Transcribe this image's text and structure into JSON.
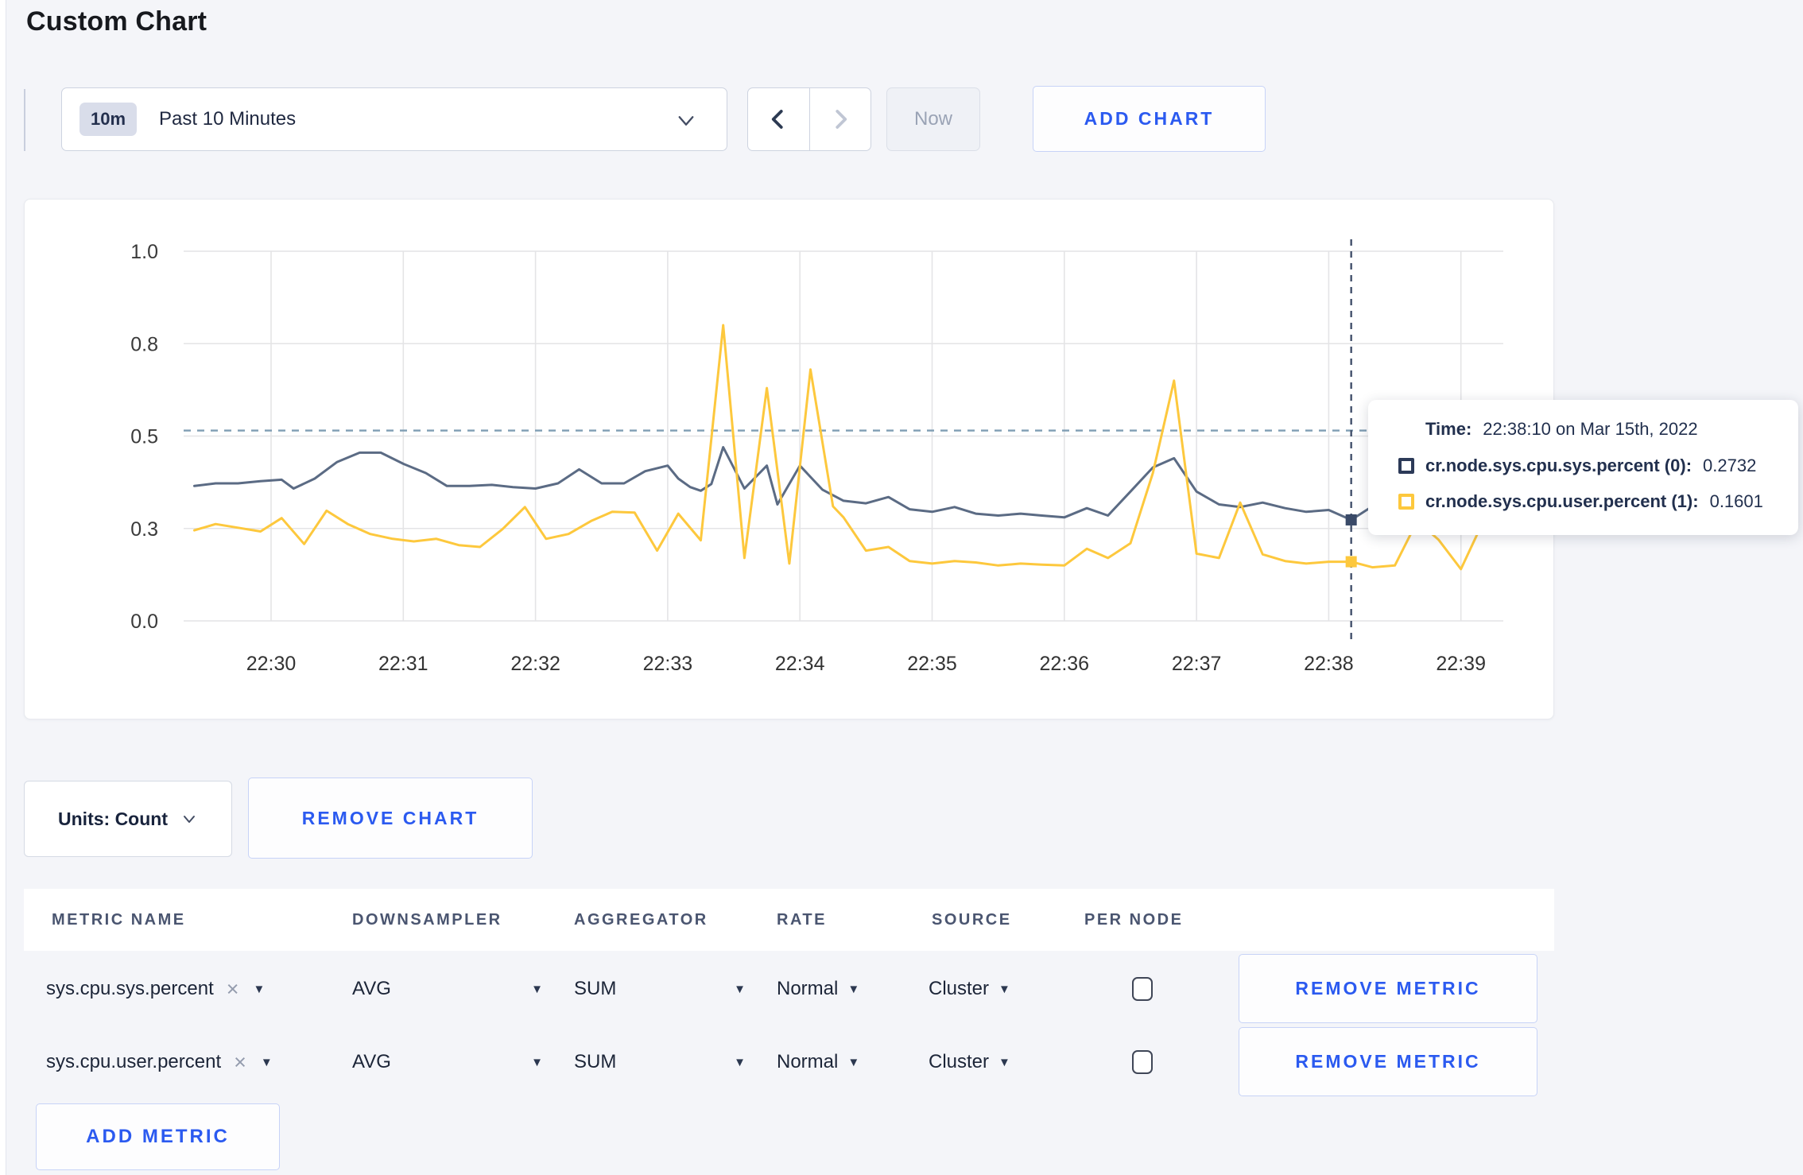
{
  "page": {
    "title": "Custom Chart"
  },
  "toolbar": {
    "timescale_badge": "10m",
    "timescale_label": "Past 10 Minutes",
    "now_label": "Now",
    "add_chart_label": "ADD CHART"
  },
  "chart_controls": {
    "units_label": "Units: Count",
    "remove_chart_label": "REMOVE CHART"
  },
  "tooltip": {
    "time_label": "Time:",
    "time_value": "22:38:10 on Mar 15th, 2022",
    "rows": [
      {
        "name": "cr.node.sys.cpu.sys.percent (0):",
        "value": "0.2732",
        "color": "#2c3a58"
      },
      {
        "name": "cr.node.sys.cpu.user.percent (1):",
        "value": "0.1601",
        "color": "#fdc83d"
      }
    ]
  },
  "chart_data": {
    "type": "line",
    "title": "",
    "xlabel": "",
    "ylabel": "",
    "ylim": [
      0,
      1
    ],
    "grid": true,
    "y_ticks": [
      {
        "value": 0,
        "label": "0.0"
      },
      {
        "value": 0.25,
        "label": "0.3"
      },
      {
        "value": 0.5,
        "label": "0.5"
      },
      {
        "value": 0.75,
        "label": "0.8"
      },
      {
        "value": 1,
        "label": "1.0"
      }
    ],
    "x_ticks": [
      {
        "minute": 30,
        "label": "22:30"
      },
      {
        "minute": 31,
        "label": "22:31"
      },
      {
        "minute": 32,
        "label": "22:32"
      },
      {
        "minute": 33,
        "label": "22:33"
      },
      {
        "minute": 34,
        "label": "22:34"
      },
      {
        "minute": 35,
        "label": "22:35"
      },
      {
        "minute": 36,
        "label": "22:36"
      },
      {
        "minute": 37,
        "label": "22:37"
      },
      {
        "minute": 38,
        "label": "22:38"
      },
      {
        "minute": 39,
        "label": "22:39"
      }
    ],
    "guideline_value": 0.515,
    "crosshair": {
      "minute": 38.17,
      "time": "22:38:10",
      "points": [
        {
          "series": "cr.node.sys.cpu.sys.percent",
          "value": 0.2732,
          "color": "#3a4a68"
        },
        {
          "series": "cr.node.sys.cpu.user.percent",
          "value": 0.1601,
          "color": "#fdc83d"
        }
      ]
    },
    "series": [
      {
        "name": "cr.node.sys.cpu.sys.percent",
        "color": "#5b6b84",
        "points": [
          [
            29.42,
            0.365
          ],
          [
            29.58,
            0.372
          ],
          [
            29.75,
            0.372
          ],
          [
            29.92,
            0.378
          ],
          [
            30.08,
            0.382
          ],
          [
            30.17,
            0.358
          ],
          [
            30.33,
            0.385
          ],
          [
            30.5,
            0.43
          ],
          [
            30.67,
            0.455
          ],
          [
            30.83,
            0.455
          ],
          [
            31.0,
            0.425
          ],
          [
            31.17,
            0.4
          ],
          [
            31.33,
            0.365
          ],
          [
            31.5,
            0.365
          ],
          [
            31.67,
            0.368
          ],
          [
            31.83,
            0.362
          ],
          [
            32.0,
            0.358
          ],
          [
            32.17,
            0.372
          ],
          [
            32.33,
            0.41
          ],
          [
            32.5,
            0.372
          ],
          [
            32.67,
            0.372
          ],
          [
            32.83,
            0.405
          ],
          [
            33.0,
            0.42
          ],
          [
            33.08,
            0.385
          ],
          [
            33.17,
            0.362
          ],
          [
            33.25,
            0.352
          ],
          [
            33.33,
            0.37
          ],
          [
            33.42,
            0.47
          ],
          [
            33.58,
            0.358
          ],
          [
            33.75,
            0.42
          ],
          [
            33.83,
            0.315
          ],
          [
            34.0,
            0.42
          ],
          [
            34.17,
            0.355
          ],
          [
            34.33,
            0.325
          ],
          [
            34.5,
            0.318
          ],
          [
            34.67,
            0.335
          ],
          [
            34.83,
            0.302
          ],
          [
            35.0,
            0.295
          ],
          [
            35.17,
            0.308
          ],
          [
            35.33,
            0.29
          ],
          [
            35.5,
            0.285
          ],
          [
            35.67,
            0.29
          ],
          [
            35.83,
            0.285
          ],
          [
            36.0,
            0.28
          ],
          [
            36.17,
            0.305
          ],
          [
            36.33,
            0.285
          ],
          [
            36.5,
            0.35
          ],
          [
            36.67,
            0.415
          ],
          [
            36.83,
            0.44
          ],
          [
            37.0,
            0.35
          ],
          [
            37.17,
            0.315
          ],
          [
            37.33,
            0.308
          ],
          [
            37.5,
            0.32
          ],
          [
            37.67,
            0.305
          ],
          [
            37.83,
            0.295
          ],
          [
            38.0,
            0.3
          ],
          [
            38.17,
            0.2732
          ],
          [
            38.33,
            0.31
          ],
          [
            38.5,
            0.315
          ],
          [
            38.67,
            0.3
          ],
          [
            38.83,
            0.3
          ],
          [
            39.0,
            0.302
          ],
          [
            39.17,
            0.3
          ],
          [
            39.25,
            0.298
          ]
        ]
      },
      {
        "name": "cr.node.sys.cpu.user.percent",
        "color": "#fdc83d",
        "points": [
          [
            29.42,
            0.245
          ],
          [
            29.58,
            0.262
          ],
          [
            29.75,
            0.252
          ],
          [
            29.92,
            0.242
          ],
          [
            30.08,
            0.278
          ],
          [
            30.25,
            0.208
          ],
          [
            30.42,
            0.298
          ],
          [
            30.58,
            0.262
          ],
          [
            30.75,
            0.235
          ],
          [
            30.92,
            0.222
          ],
          [
            31.08,
            0.215
          ],
          [
            31.25,
            0.222
          ],
          [
            31.42,
            0.205
          ],
          [
            31.58,
            0.2
          ],
          [
            31.75,
            0.248
          ],
          [
            31.92,
            0.308
          ],
          [
            32.08,
            0.222
          ],
          [
            32.25,
            0.235
          ],
          [
            32.42,
            0.27
          ],
          [
            32.58,
            0.295
          ],
          [
            32.75,
            0.293
          ],
          [
            32.92,
            0.19
          ],
          [
            33.08,
            0.29
          ],
          [
            33.25,
            0.218
          ],
          [
            33.42,
            0.8
          ],
          [
            33.58,
            0.17
          ],
          [
            33.75,
            0.63
          ],
          [
            33.92,
            0.155
          ],
          [
            34.08,
            0.68
          ],
          [
            34.25,
            0.31
          ],
          [
            34.33,
            0.28
          ],
          [
            34.5,
            0.19
          ],
          [
            34.67,
            0.2
          ],
          [
            34.83,
            0.162
          ],
          [
            35.0,
            0.155
          ],
          [
            35.17,
            0.162
          ],
          [
            35.33,
            0.158
          ],
          [
            35.5,
            0.15
          ],
          [
            35.67,
            0.155
          ],
          [
            35.83,
            0.152
          ],
          [
            36.0,
            0.15
          ],
          [
            36.17,
            0.195
          ],
          [
            36.33,
            0.17
          ],
          [
            36.5,
            0.21
          ],
          [
            36.67,
            0.4
          ],
          [
            36.83,
            0.65
          ],
          [
            37.0,
            0.182
          ],
          [
            37.17,
            0.17
          ],
          [
            37.33,
            0.32
          ],
          [
            37.5,
            0.18
          ],
          [
            37.67,
            0.162
          ],
          [
            37.83,
            0.155
          ],
          [
            38.0,
            0.16
          ],
          [
            38.17,
            0.1601
          ],
          [
            38.33,
            0.145
          ],
          [
            38.5,
            0.15
          ],
          [
            38.67,
            0.27
          ],
          [
            38.83,
            0.22
          ],
          [
            39.0,
            0.14
          ],
          [
            39.17,
            0.27
          ],
          [
            39.25,
            0.255
          ]
        ]
      }
    ]
  },
  "metrics_table": {
    "headers": [
      "METRIC NAME",
      "DOWNSAMPLER",
      "AGGREGATOR",
      "RATE",
      "SOURCE",
      "PER NODE"
    ],
    "rows": [
      {
        "name": "sys.cpu.sys.percent",
        "downsampler": "AVG",
        "aggregator": "SUM",
        "rate": "Normal",
        "source": "Cluster",
        "per_node_checked": false,
        "remove_label": "REMOVE METRIC"
      },
      {
        "name": "sys.cpu.user.percent",
        "downsampler": "AVG",
        "aggregator": "SUM",
        "rate": "Normal",
        "source": "Cluster",
        "per_node_checked": false,
        "remove_label": "REMOVE METRIC"
      }
    ],
    "add_metric_label": "ADD METRIC"
  },
  "colors": {
    "accent_blue": "#2b5af0",
    "series_sys": "#5b6b84",
    "series_user": "#fdc83d",
    "page_background": "#f4f5f9"
  }
}
